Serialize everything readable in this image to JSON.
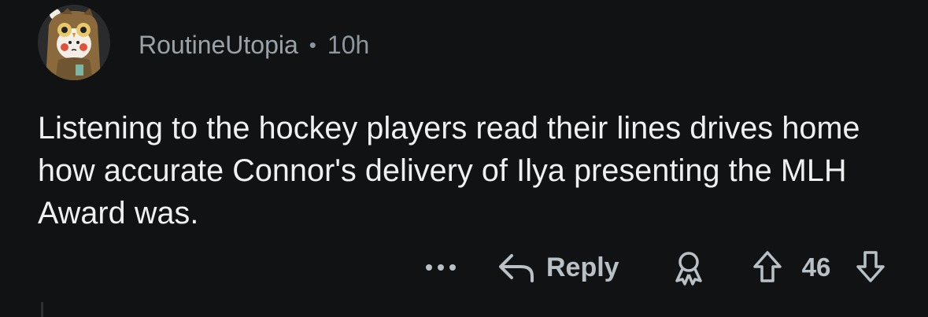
{
  "comment": {
    "author": "RoutineUtopia",
    "separator": "•",
    "time_ago": "10h",
    "text": "Listening to the hockey players read their lines drives home how accurate Connor's delivery of Ilya presenting the MLH Award was.",
    "avatar_icon": "owl-snoo-avatar-icon"
  },
  "actions": {
    "more_icon": "more-dots-icon",
    "reply_icon": "reply-arrow-icon",
    "reply_label": "Reply",
    "award_icon": "award-icon",
    "upvote_icon": "upvote-arrow-icon",
    "score": "46",
    "downvote_icon": "downvote-arrow-icon"
  },
  "colors": {
    "background": "#111213",
    "text_primary": "#eef0f2",
    "text_meta": "#8e979d",
    "action_gray": "#b9c1c6"
  }
}
